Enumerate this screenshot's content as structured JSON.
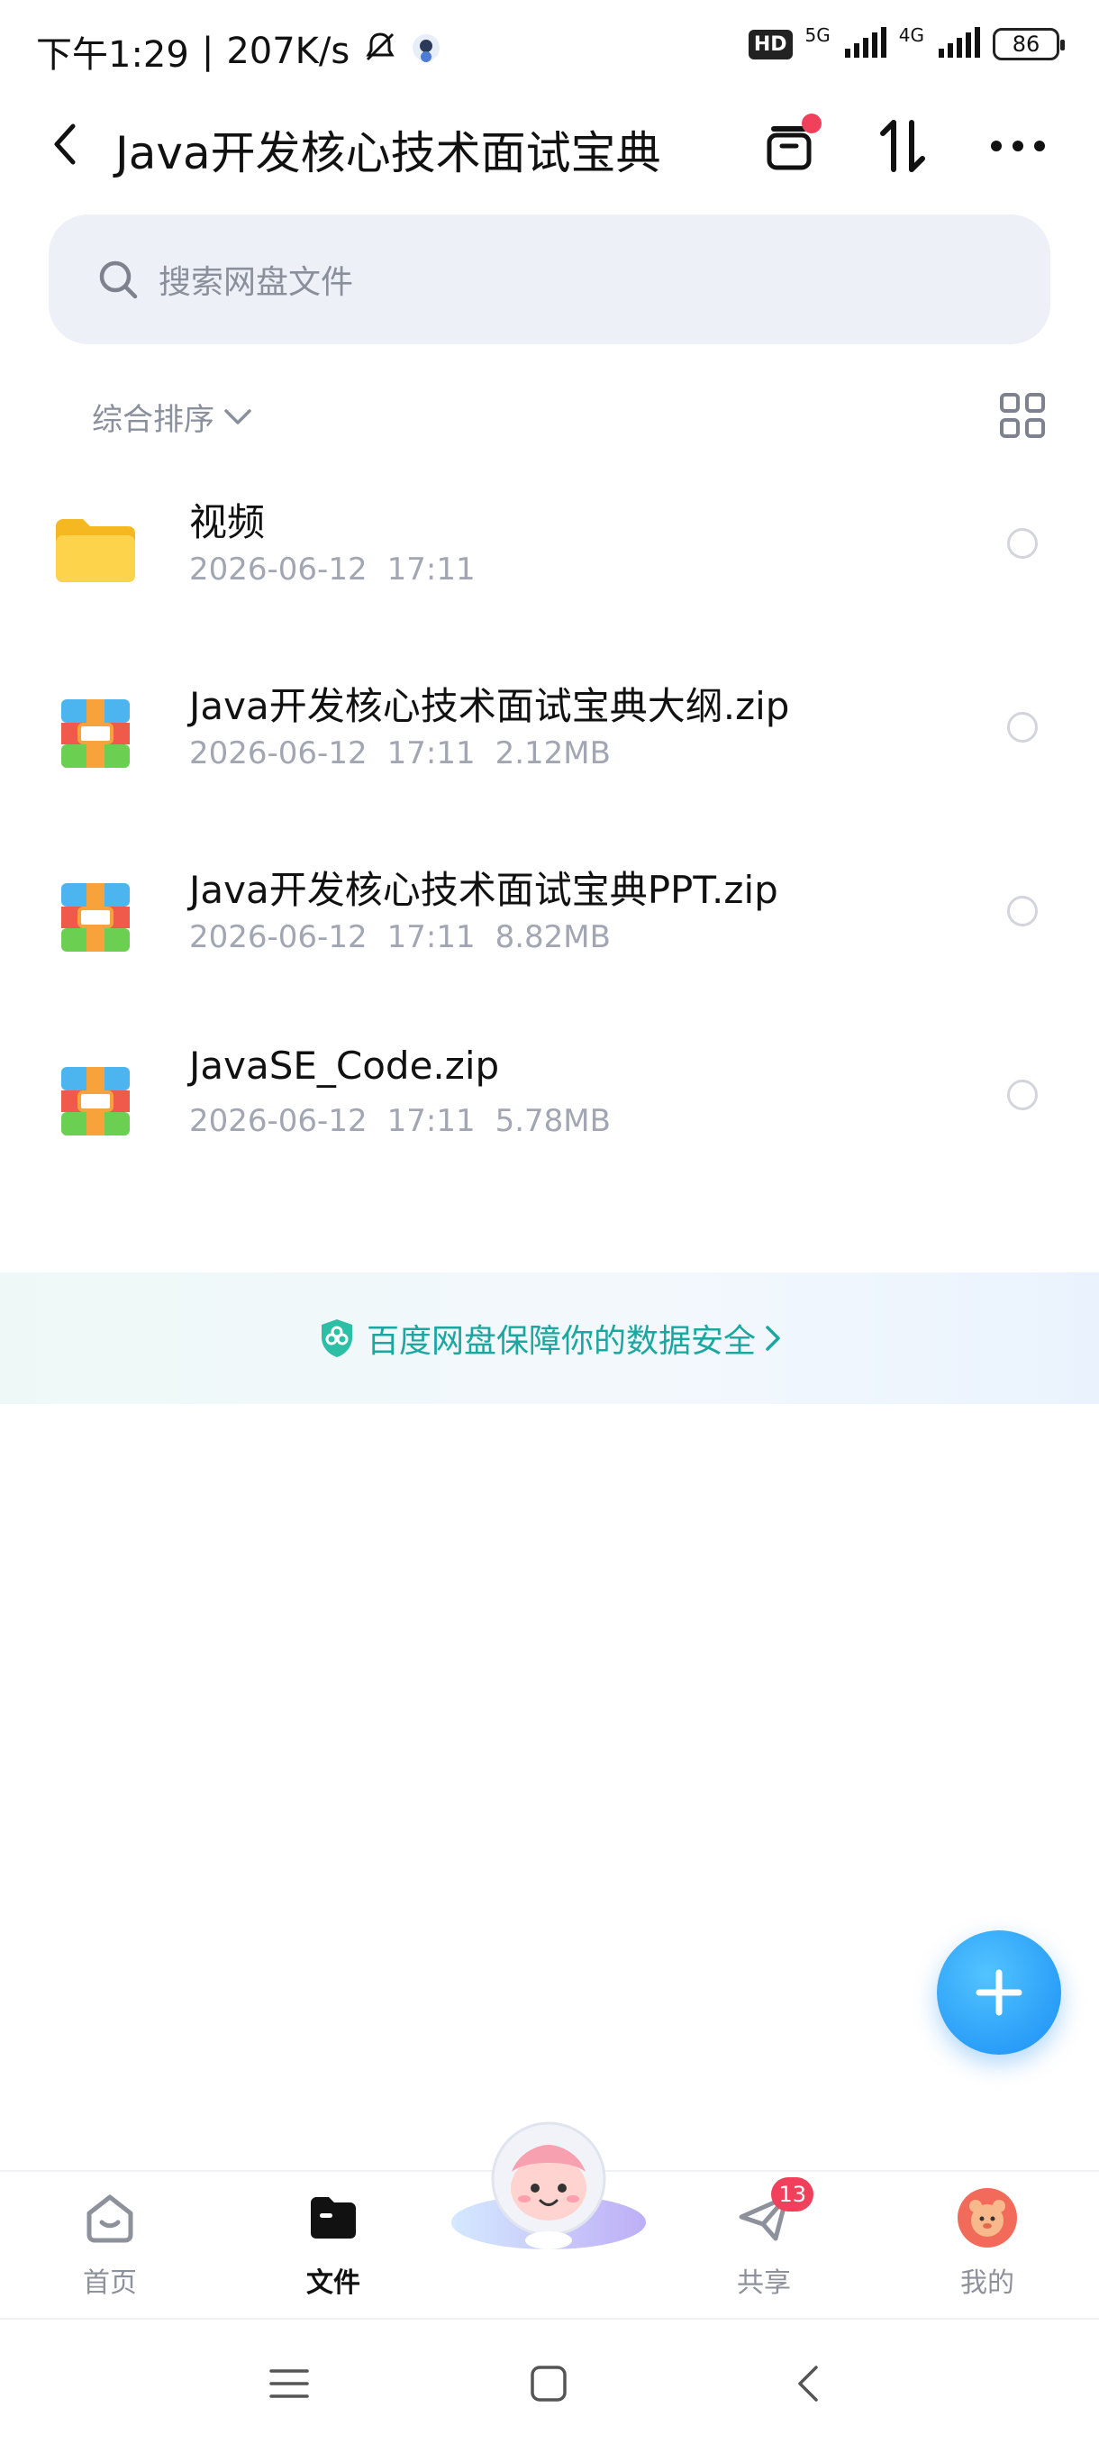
{
  "status_bar": {
    "time": "下午1:29",
    "speed": "207K/s",
    "hd": "HD",
    "net1": "5G",
    "net2": "4G",
    "battery": "86"
  },
  "header": {
    "title": "Java开发核心技术面试宝典"
  },
  "search": {
    "placeholder": "搜索网盘文件"
  },
  "sort": {
    "label": "综合排序"
  },
  "files": [
    {
      "name": "视频",
      "date": "2026-06-12",
      "time": "17:11",
      "size": "",
      "type": "folder"
    },
    {
      "name": "Java开发核心技术面试宝典大纲.zip",
      "date": "2026-06-12",
      "time": "17:11",
      "size": "2.12MB",
      "type": "zip"
    },
    {
      "name": "Java开发核心技术面试宝典PPT.zip",
      "date": "2026-06-12",
      "time": "17:11",
      "size": "8.82MB",
      "type": "zip"
    },
    {
      "name": "JavaSE_Code.zip",
      "date": "2026-06-12",
      "time": "17:11",
      "size": "5.78MB",
      "type": "zip"
    }
  ],
  "banner": {
    "text": "百度网盘保障你的数据安全"
  },
  "bottom_nav": {
    "home": "首页",
    "files": "文件",
    "share": "共享",
    "share_badge": "13",
    "me": "我的"
  },
  "colors": {
    "accent": "#1a8ef5",
    "badge": "#f0405b",
    "banner_text": "#1ba7a0"
  }
}
